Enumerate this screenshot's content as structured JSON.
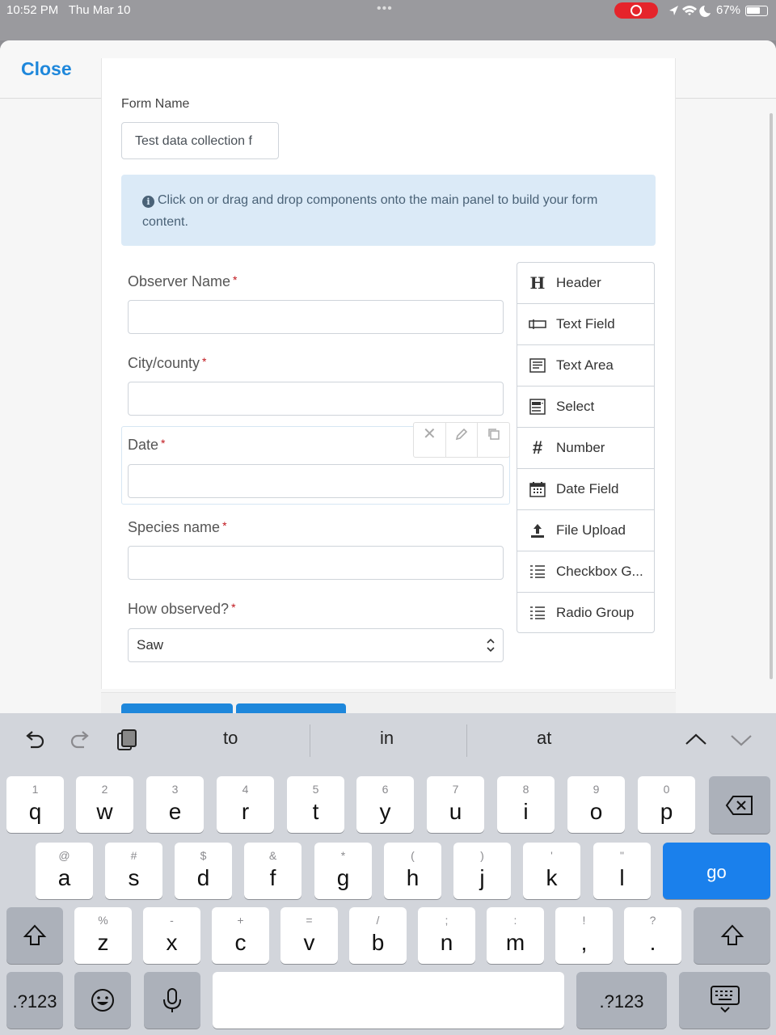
{
  "status_bar": {
    "time": "10:52 PM",
    "date": "Thu Mar 10",
    "battery": "67%",
    "battery_level": 0.67
  },
  "sheet": {
    "close_label": "Close"
  },
  "form": {
    "name_label": "Form Name",
    "name_value": "Test data collection f",
    "info_text": "Click on or drag and drop components onto the main panel to build your form content.",
    "fields": [
      {
        "label": "Observer Name",
        "required": "*"
      },
      {
        "label": "City/county",
        "required": "*"
      },
      {
        "label": "Date",
        "required": "*"
      },
      {
        "label": "Species name",
        "required": "*"
      },
      {
        "label": "How observed?",
        "required": "*",
        "value": "Saw"
      }
    ]
  },
  "palette": [
    {
      "label": "Header",
      "icon": "header-icon"
    },
    {
      "label": "Text Field",
      "icon": "text-field-icon"
    },
    {
      "label": "Text Area",
      "icon": "text-area-icon"
    },
    {
      "label": "Select",
      "icon": "select-icon"
    },
    {
      "label": "Number",
      "icon": "hash-icon"
    },
    {
      "label": "Date Field",
      "icon": "calendar-icon"
    },
    {
      "label": "File Upload",
      "icon": "upload-icon"
    },
    {
      "label": "Checkbox G...",
      "icon": "list-icon"
    },
    {
      "label": "Radio Group",
      "icon": "list-icon"
    }
  ],
  "keyboard": {
    "predictions": [
      "to",
      "in",
      "at"
    ],
    "row1": [
      {
        "h": "1",
        "c": "q"
      },
      {
        "h": "2",
        "c": "w"
      },
      {
        "h": "3",
        "c": "e"
      },
      {
        "h": "4",
        "c": "r"
      },
      {
        "h": "5",
        "c": "t"
      },
      {
        "h": "6",
        "c": "y"
      },
      {
        "h": "7",
        "c": "u"
      },
      {
        "h": "8",
        "c": "i"
      },
      {
        "h": "9",
        "c": "o"
      },
      {
        "h": "0",
        "c": "p"
      }
    ],
    "row2": [
      {
        "h": "@",
        "c": "a"
      },
      {
        "h": "#",
        "c": "s"
      },
      {
        "h": "$",
        "c": "d"
      },
      {
        "h": "&",
        "c": "f"
      },
      {
        "h": "*",
        "c": "g"
      },
      {
        "h": "(",
        "c": "h"
      },
      {
        "h": ")",
        "c": "j"
      },
      {
        "h": "'",
        "c": "k"
      },
      {
        "h": "\"",
        "c": "l"
      }
    ],
    "row3": [
      {
        "h": "%",
        "c": "z"
      },
      {
        "h": "-",
        "c": "x"
      },
      {
        "h": "+",
        "c": "c"
      },
      {
        "h": "=",
        "c": "v"
      },
      {
        "h": "/",
        "c": "b"
      },
      {
        "h": ";",
        "c": "n"
      },
      {
        "h": ":",
        "c": "m"
      },
      {
        "h": "!",
        "c": ","
      },
      {
        "h": "?",
        "c": "."
      }
    ],
    "go_label": "go",
    "numbers_label": ".?123"
  }
}
